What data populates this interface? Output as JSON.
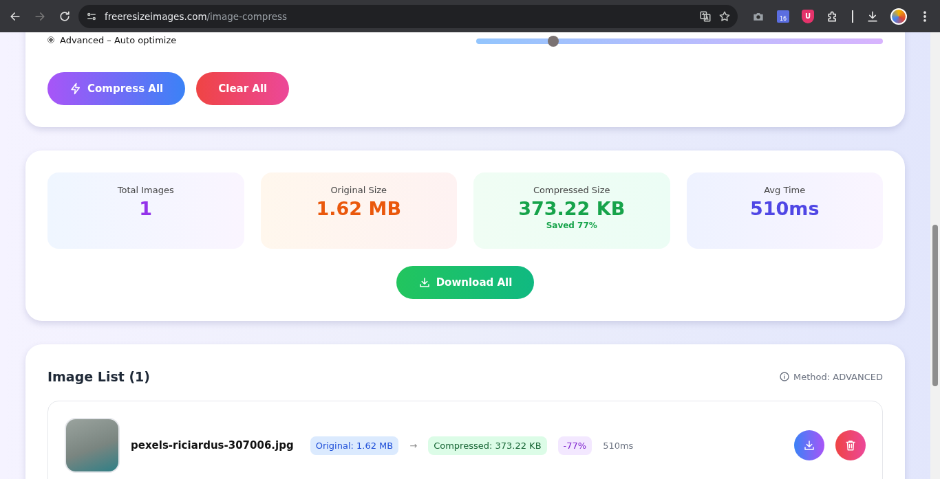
{
  "browser": {
    "back_enabled": true,
    "forward_enabled": false,
    "address": {
      "domain": "freeresizeimages.com",
      "path": "/image-compress"
    },
    "calendar_badge": "16",
    "shield_letter": "U"
  },
  "settings": {
    "methods": [
      {
        "label": "Advanced – Auto optimize",
        "selected": true
      }
    ],
    "quality": {
      "level": 0.19
    },
    "buttons": [
      {
        "kind": "compress",
        "label": "Compress All"
      },
      {
        "kind": "clear",
        "label": "Clear All"
      }
    ]
  },
  "stats": {
    "items": [
      {
        "label": "Total Images",
        "value": "1",
        "color": "#9333ea"
      },
      {
        "label": "Original Size",
        "value": "1.62 MB",
        "color": "#ea580c"
      },
      {
        "label": "Compressed Size",
        "value": "373.22 KB",
        "color": "#16a34a",
        "note": "Saved 77%"
      },
      {
        "label": "Avg Time",
        "value": "510ms",
        "color": "#4f46e5"
      }
    ],
    "download_button": "Download All"
  },
  "image_list": {
    "title": "Image List (1)",
    "method": "Method: ADVANCED",
    "images": [
      {
        "name": "pexels-riciardus-307006.jpg",
        "original": "Original: 1.62 MB",
        "arrow": "→",
        "compressed": "Compressed: 373.22 KB",
        "reduction": "-77%",
        "time": "510ms"
      }
    ]
  }
}
